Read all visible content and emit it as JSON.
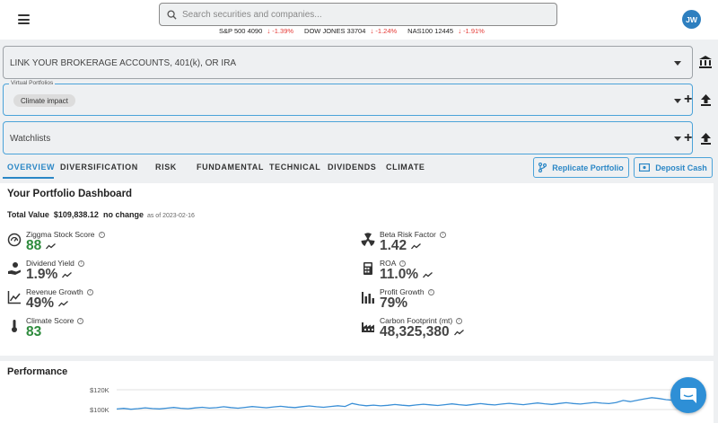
{
  "header": {
    "search_placeholder": "Search securities and companies...",
    "avatar_initials": "JW",
    "tickers": [
      {
        "name": "S&P 500",
        "value": "4090",
        "change": "-1.39%"
      },
      {
        "name": "DOW JONES",
        "value": "33704",
        "change": "-1.24%"
      },
      {
        "name": "NAS100",
        "value": "12445",
        "change": "-1.91%"
      }
    ]
  },
  "brokerage": {
    "label": "LINK YOUR BROKERAGE ACCOUNTS, 401(k), OR IRA"
  },
  "virtual_portfolios": {
    "legend": "Virtual Portfolios",
    "selected": "Climate impact"
  },
  "watchlists": {
    "label": "Watchlists"
  },
  "tabs": [
    "OVERVIEW",
    "DIVERSIFICATION",
    "RISK",
    "FUNDAMENTAL",
    "TECHNICAL",
    "DIVIDENDS",
    "CLIMATE"
  ],
  "buttons": {
    "replicate": "Replicate Portfolio",
    "deposit": "Deposit Cash"
  },
  "dashboard": {
    "title": "Your Portfolio Dashboard",
    "total_label": "Total Value",
    "total_value": "$109,838.12",
    "change_text": "no change",
    "as_of": "as of 2023-02-16",
    "metrics": [
      {
        "label": "Ziggma Stock Score",
        "value": "88",
        "color": "#2e8b3d",
        "icon": "gauge-icon"
      },
      {
        "label": "Dividend Yield",
        "value": "1.9%",
        "icon": "hand-coin-icon"
      },
      {
        "label": "Revenue Growth",
        "value": "49%",
        "icon": "line-chart-icon"
      },
      {
        "label": "Climate Score",
        "value": "83",
        "color": "#2e8b3d",
        "icon": "thermometer-icon"
      },
      {
        "label": "Beta Risk Factor",
        "value": "1.42",
        "icon": "radiation-icon"
      },
      {
        "label": "ROA",
        "value": "11.0%",
        "icon": "calculator-icon"
      },
      {
        "label": "Profit Growth",
        "value": "79%",
        "icon": "bar-chart-icon"
      },
      {
        "label": "Carbon Footprint (mt)",
        "value": "48,325,380",
        "icon": "factory-icon"
      }
    ]
  },
  "performance": {
    "title": "Performance",
    "chart_data": {
      "type": "line",
      "y_ticks": [
        "$120K",
        "$100K"
      ],
      "ylim": [
        95000,
        125000
      ],
      "series": [
        {
          "values": [
            100500,
            101200,
            100300,
            100900,
            101700,
            101000,
            100600,
            101400,
            102100,
            101300,
            100800,
            101600,
            102300,
            101500,
            101900,
            102800,
            102000,
            101400,
            102200,
            103000,
            102400,
            101800,
            102600,
            103300,
            102500,
            102000,
            102900,
            103600,
            102800,
            102300,
            103100,
            103800,
            103100,
            106200,
            104600,
            103800,
            104500,
            103700,
            104300,
            105100,
            104400,
            103800,
            104600,
            105400,
            104700,
            104100,
            104900,
            105700,
            104900,
            104300,
            105200,
            106000,
            105200,
            104600,
            105500,
            106300,
            105500,
            104900,
            105800,
            106600,
            105800,
            105200,
            106100,
            106900,
            106100,
            105500,
            106400,
            107200,
            106500,
            106000,
            107000,
            109200,
            108000,
            109500,
            110800,
            112000,
            111200,
            110000,
            109400
          ]
        }
      ]
    }
  },
  "colors": {
    "accent": "#2b87c6",
    "positive": "#2e8b3d",
    "negative": "#e53935",
    "chart_line": "#3a8fd6"
  }
}
